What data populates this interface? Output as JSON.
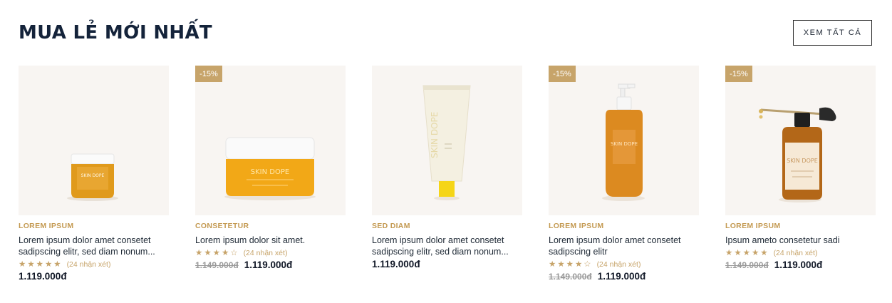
{
  "section": {
    "title": "MUA LẺ MỚI NHẤT",
    "view_all_label": "XEM TẤT CẢ"
  },
  "colors": {
    "accent": "#c7a46a",
    "thumb_bg": "#f8f5f2",
    "title": "#14233a"
  },
  "products": [
    {
      "category": "LOREM IPSUM",
      "name": "Lorem ipsum dolor amet consetet sadipscing elitr, sed diam nonum...",
      "rating": 5,
      "reviews": "(24 nhận xét)",
      "old_price": "",
      "price": "1.119.000đ",
      "badge": "",
      "image": "small-amber-jar",
      "label_text": "SKIN DOPE"
    },
    {
      "category": "CONSETETUR",
      "name": "Lorem ipsum dolor sit amet.",
      "rating": 4,
      "reviews": "(24 nhận xét)",
      "old_price": "1.149.000đ",
      "price": "1.119.000đ",
      "badge": "-15%",
      "image": "large-amber-jar",
      "label_text": "SKIN DOPE"
    },
    {
      "category": "SED DIAM",
      "name": "Lorem ipsum dolor amet consetet sadipscing elitr, sed diam nonum...",
      "rating": 0,
      "reviews": "",
      "old_price": "",
      "price": "1.119.000đ",
      "badge": "",
      "image": "cream-tube",
      "label_text": "SKIN DOPE"
    },
    {
      "category": "LOREM IPSUM",
      "name": "Lorem ipsum dolor amet consetet sadipscing elitr",
      "rating": 4,
      "reviews": "(24 nhận xét)",
      "old_price": "1.149.000đ",
      "price": "1.119.000đ",
      "badge": "-15%",
      "image": "pump-bottle",
      "label_text": "SKIN DOPE"
    },
    {
      "category": "LOREM IPSUM",
      "name": "Ipsum ameto consetetur sadi",
      "rating": 5,
      "reviews": "(24 nhận xét)",
      "old_price": "1.149.000đ",
      "price": "1.119.000đ",
      "badge": "-15%",
      "image": "dropper-bottle",
      "label_text": "SKIN DOPE"
    }
  ]
}
